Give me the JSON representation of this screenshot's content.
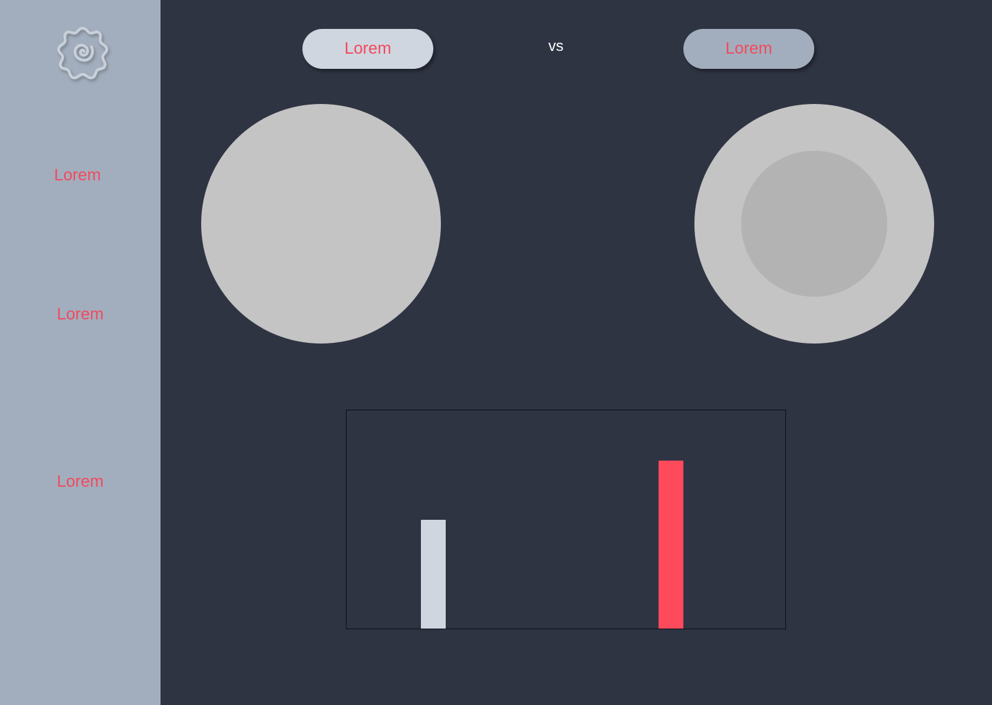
{
  "sidebar": {
    "logo_icon": "spiral-flower-icon",
    "items": [
      {
        "label": "Lorem"
      },
      {
        "label": "Lorem"
      },
      {
        "label": "Lorem"
      }
    ]
  },
  "compare": {
    "left_button": "Lorem",
    "vs_label": "vs",
    "right_button": "Lorem"
  },
  "colors": {
    "accent": "#F24A5E",
    "sidebar": "#A2AEBD",
    "background": "#2F3443",
    "light": "#CFD6E0",
    "placeholder": "#C4C4C4"
  },
  "chart_data": {
    "type": "bar",
    "categories": [
      "",
      ""
    ],
    "values": [
      50,
      77
    ],
    "colors": [
      "#CFD6E0",
      "#FF4A5C"
    ],
    "ylim": [
      0,
      100
    ]
  }
}
